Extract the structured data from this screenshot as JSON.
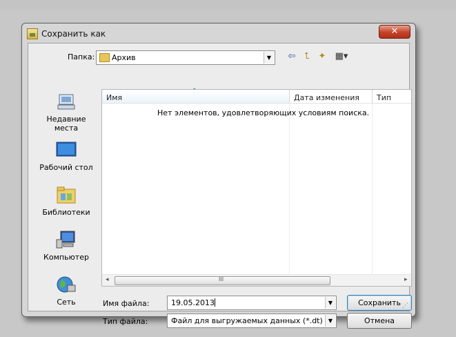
{
  "window": {
    "title": "Сохранить как",
    "close_symbol": "✕"
  },
  "location": {
    "label": "Папка:",
    "value": "Архив"
  },
  "toolbar": {
    "back_symbol": "⇦",
    "up_symbol": "⮤",
    "new_folder_symbol": "✦",
    "view_symbol": "▦▾"
  },
  "places": [
    {
      "label": "Недавние места",
      "icon": "recent-places-icon"
    },
    {
      "label": "Рабочий стол",
      "icon": "desktop-icon"
    },
    {
      "label": "Библиотеки",
      "icon": "libraries-icon"
    },
    {
      "label": "Компьютер",
      "icon": "computer-icon"
    },
    {
      "label": "Сеть",
      "icon": "network-icon"
    }
  ],
  "file_list": {
    "columns": [
      "Имя",
      "Дата изменения",
      "Тип"
    ],
    "empty_message": "Нет элементов, удовлетворяющих условиям поиска.",
    "sort_indicator": "⌃"
  },
  "scrollbar": {
    "left_arrow": "◂",
    "right_arrow": "▸",
    "grip": "III"
  },
  "filename": {
    "label": "Имя файла:",
    "value": "19.05.2013"
  },
  "filetype": {
    "label": "Тип файла:",
    "value": "Файл для выгружаемых данных (*.dt)"
  },
  "buttons": {
    "save": "Сохранить",
    "cancel": "Отмена"
  },
  "colors": {
    "title_close": "#c4412a",
    "dialog_bg": "#d6d6d6",
    "client_bg": "#ececec",
    "accent": "#3c7fb1"
  }
}
